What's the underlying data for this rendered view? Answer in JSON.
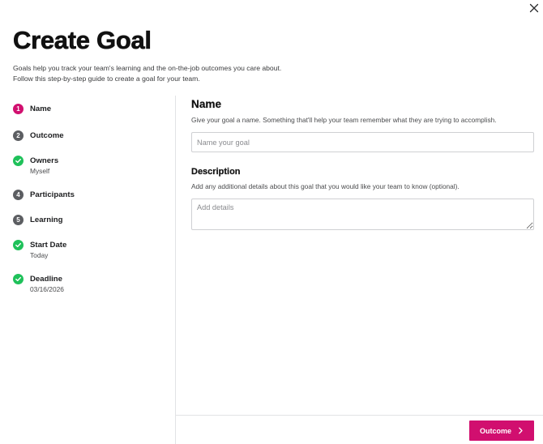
{
  "header": {
    "close_icon": "close-icon",
    "title": "Create Goal",
    "subtitle_line1": "Goals help you track your team's learning and the on-the-job outcomes you care about.",
    "subtitle_line2": "Follow this step-by-step guide to create a goal for your team."
  },
  "steps": [
    {
      "badge": "1",
      "label": "Name",
      "value": "",
      "state": "active"
    },
    {
      "badge": "2",
      "label": "Outcome",
      "value": "",
      "state": "pending"
    },
    {
      "badge": "check",
      "label": "Owners",
      "value": "Myself",
      "state": "done"
    },
    {
      "badge": "4",
      "label": "Participants",
      "value": "",
      "state": "pending"
    },
    {
      "badge": "5",
      "label": "Learning",
      "value": "",
      "state": "pending"
    },
    {
      "badge": "check",
      "label": "Start Date",
      "value": "Today",
      "state": "done"
    },
    {
      "badge": "check",
      "label": "Deadline",
      "value": "03/16/2026",
      "state": "done"
    }
  ],
  "form": {
    "name_title": "Name",
    "name_desc": "Give your goal a name. Something that'll help your team remember what they are trying to accomplish.",
    "name_value": "",
    "name_placeholder": "Name your goal",
    "description_title": "Description",
    "description_desc": "Add any additional details about this goal that you would like your team to know (optional).",
    "description_value": "",
    "description_placeholder": "Add details"
  },
  "footer": {
    "next_label": "Outcome",
    "next_icon": "chevron-right-icon"
  },
  "colors": {
    "accent": "#d10f6f",
    "done": "#1fc15a",
    "pending": "#5c5e62"
  }
}
